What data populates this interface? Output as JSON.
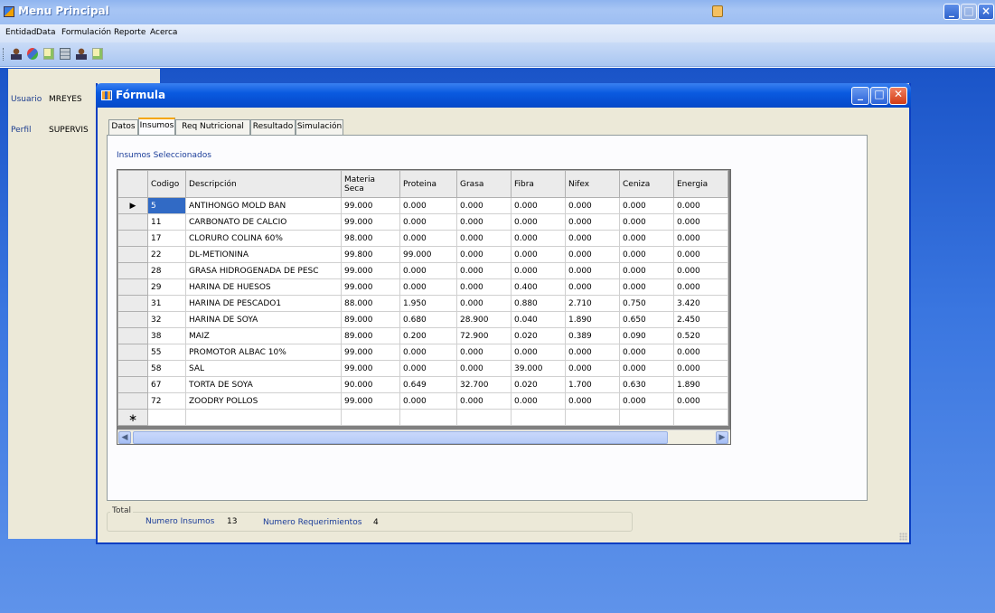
{
  "main_window": {
    "title": "Menu Principal",
    "menu": [
      "Entidad",
      "Data",
      "Formulación",
      "Reporte",
      "Acerca"
    ],
    "toolbar_icons": [
      "user-icon",
      "database-icon",
      "document-icon",
      "calculator-icon",
      "user-icon",
      "document-icon"
    ]
  },
  "user_panel": {
    "usuario_label": "Usuario",
    "usuario_value": "MREYES",
    "perfil_label": "Perfil",
    "perfil_value": "SUPERVIS"
  },
  "child_window": {
    "title": "Fórmula",
    "tabs": [
      {
        "label": "Datos",
        "active": false
      },
      {
        "label": "Insumos",
        "active": true
      },
      {
        "label": "Req Nutricional",
        "active": false
      },
      {
        "label": "Resultado",
        "active": false
      },
      {
        "label": "Simulación",
        "active": false
      }
    ],
    "section_title": "Insumos Seleccionados",
    "grid": {
      "columns": [
        "Codigo",
        "Descripción",
        "Materia Seca",
        "Proteina",
        "Grasa",
        "Fibra",
        "Nifex",
        "Ceniza",
        "Energia"
      ],
      "rows": [
        [
          "5",
          "ANTIHONGO MOLD BAN",
          "99.000",
          "0.000",
          "0.000",
          "0.000",
          "0.000",
          "0.000",
          "0.000"
        ],
        [
          "11",
          "CARBONATO DE CALCIO",
          "99.000",
          "0.000",
          "0.000",
          "0.000",
          "0.000",
          "0.000",
          "0.000"
        ],
        [
          "17",
          "CLORURO COLINA 60%",
          "98.000",
          "0.000",
          "0.000",
          "0.000",
          "0.000",
          "0.000",
          "0.000"
        ],
        [
          "22",
          "DL-METIONINA",
          "99.800",
          "99.000",
          "0.000",
          "0.000",
          "0.000",
          "0.000",
          "0.000"
        ],
        [
          "28",
          "GRASA HIDROGENADA DE PESC",
          "99.000",
          "0.000",
          "0.000",
          "0.000",
          "0.000",
          "0.000",
          "0.000"
        ],
        [
          "29",
          "HARINA DE HUESOS",
          "99.000",
          "0.000",
          "0.000",
          "0.400",
          "0.000",
          "0.000",
          "0.000"
        ],
        [
          "31",
          "HARINA DE PESCADO1",
          "88.000",
          "1.950",
          "0.000",
          "0.880",
          "2.710",
          "0.750",
          "3.420"
        ],
        [
          "32",
          "HARINA DE SOYA",
          "89.000",
          "0.680",
          "28.900",
          "0.040",
          "1.890",
          "0.650",
          "2.450"
        ],
        [
          "38",
          "MAIZ",
          "89.000",
          "0.200",
          "72.900",
          "0.020",
          "0.389",
          "0.090",
          "0.520"
        ],
        [
          "55",
          "PROMOTOR ALBAC 10%",
          "99.000",
          "0.000",
          "0.000",
          "0.000",
          "0.000",
          "0.000",
          "0.000"
        ],
        [
          "58",
          "SAL",
          "99.000",
          "0.000",
          "0.000",
          "39.000",
          "0.000",
          "0.000",
          "0.000"
        ],
        [
          "67",
          "TORTA DE SOYA",
          "90.000",
          "0.649",
          "32.700",
          "0.020",
          "1.700",
          "0.630",
          "1.890"
        ],
        [
          "72",
          "ZOODRY POLLOS",
          "99.000",
          "0.000",
          "0.000",
          "0.000",
          "0.000",
          "0.000",
          "0.000"
        ]
      ],
      "current_row_marker": "▶",
      "new_row_marker": "∗"
    },
    "total": {
      "legend": "Total",
      "numero_insumos_label": "Numero Insumos",
      "numero_insumos_value": "13",
      "numero_requerimientos_label": "Numero Requerimientos",
      "numero_requerimientos_value": "4"
    }
  },
  "colors": {
    "title_bar": "#0548c8",
    "desktop": "#3a76e0",
    "selected_cell": "#316ac5",
    "label_blue": "#1a3c99"
  }
}
